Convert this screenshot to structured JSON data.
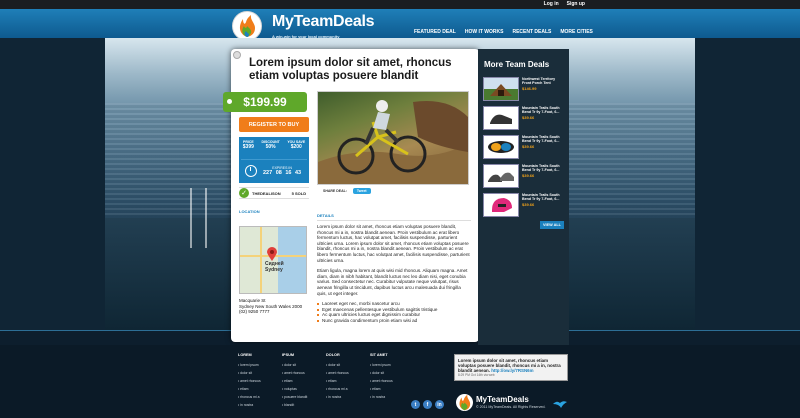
{
  "top_bar": {
    "login": "Log in",
    "signup": "Sign up"
  },
  "header": {
    "brand": "MyTeamDeals",
    "tagline": "A win-win for your local community",
    "nav": [
      "FEATURED DEAL",
      "HOW IT WORKS",
      "RECENT DEALS",
      "MORE CITIES"
    ]
  },
  "deal": {
    "title": "Lorem ipsum dolor sit amet, rhoncus etiam voluptas posuere blandit",
    "price": "$199.99",
    "register_label": "REGISTER TO BUY",
    "stats": [
      {
        "label": "PRICE",
        "value": "$399"
      },
      {
        "label": "DISCOUNT",
        "value": "50%"
      },
      {
        "label": "YOU SAVE",
        "value": "$200"
      }
    ],
    "timer_label": "EXPIRES IN",
    "timer_value": "227 08 16 43",
    "deal_on": "THEDEALISON",
    "sold": "5 SOLD",
    "share_label": "SHARE DEAL:",
    "tweet_label": "Tweet",
    "location_label": "LOCATION",
    "map_city_local": "Сидней",
    "map_city": "Sydney",
    "address_line1": "Macquarie St",
    "address_line2": "Sydney New South Wales 2000",
    "address_line3": "(02) 9250 7777",
    "details_label": "DETAILS",
    "paragraph1": "Lorem ipsum dolor sit amet, rhoncus etiam voluptas posuere blandit, rhoncus mi a in, nostra blandit aenean. Proin vestibulum ac erat libero fermentum luctus, hac volutpat amet, facilisis suspendisse, parturient ultricies urna. Lorem ipsum dolor sit amet, rhoncus etiam voluptas posuere blandit, rhoncus mi a in, nostra blandit aenean. Proin vestibulum ac erat libero fermentum luctus, hac volutpat amet, facilisis suspendisse, parturient ultricies urna.",
    "paragraph2": "Etiam ligula, magna lorem at quis wisi mid rhoncus. Aliquam magna. Amet diam, diam in nibh habitant, blandit luctus nec leo diam nisi, eget conubia varius. Sed consectetur nec. Curabitur vulputate neque volutpat, risus aenean fringilla ut tincidunt, dapibus luctus arcu malesuada dui fringilla quis, ut eget integer.",
    "bullets": [
      "Laoreet eget nec, morbi nascetur arcu",
      "Eget maecenas pellentesque vestibulum sagittis tristique",
      "Ac quam ultricies luctus eget dignissim curabitur",
      "Nunc gravida condimentum proin etiam wisi ad"
    ]
  },
  "sidebar": {
    "title": "More Team Deals",
    "items": [
      {
        "title": "Northwest Territory Front Porch Tent",
        "price": "$146.99"
      },
      {
        "title": "Mountain Trails South Bend Tr 9y 7-Foot, 6...",
        "price": "$39.66"
      },
      {
        "title": "Mountain Trails South Bend Tr 9y 7-Foot, 6...",
        "price": "$39.66"
      },
      {
        "title": "Mountain Trails South Bend Tr 9y 7-Foot, 6...",
        "price": "$39.66"
      },
      {
        "title": "Mountain Trails South Bend Tr 9y 7-Foot, 6...",
        "price": "$39.66"
      }
    ],
    "view_all": "VIEW ALL"
  },
  "footer": {
    "columns": [
      {
        "heading": "LOREM",
        "links": [
          "lorem ipsum",
          "dolor sit",
          "amet rhoncus",
          "etiam",
          "rhoncus mi a",
          "in nostra"
        ]
      },
      {
        "heading": "IPSUM",
        "links": [
          "dolor sit",
          "amet rhoncus",
          "etiam",
          "voluptas",
          "posuere blandit",
          "blandit"
        ]
      },
      {
        "heading": "DOLOR",
        "links": [
          "dolor sit",
          "amet rhoncus",
          "etiam",
          "rhoncus mi a",
          "in nostra"
        ]
      },
      {
        "heading": "SIT AMET",
        "links": [
          "lorem ipsum",
          "dolor sit",
          "amet rhoncus",
          "etiam",
          "in nostra"
        ]
      }
    ],
    "tweet_text": "Lorem ipsum dolor sit amet, rhoncus etiam voluptas posuere blandit, rhoncus mi a in, nostra blandit aenean.",
    "tweet_link": "http://ow.ly/7RSN6m",
    "tweet_meta": "8:29 PM Oct 14th via web",
    "brand": "MyTeamDeals",
    "copyright": "© 2011 MyTeamDeals. All Rights Reserved."
  },
  "colors": {
    "brand_blue": "#1b81be",
    "accent_orange": "#f07d1a",
    "price_green": "#5fa82a",
    "header_blue": "#0e5a8f"
  }
}
